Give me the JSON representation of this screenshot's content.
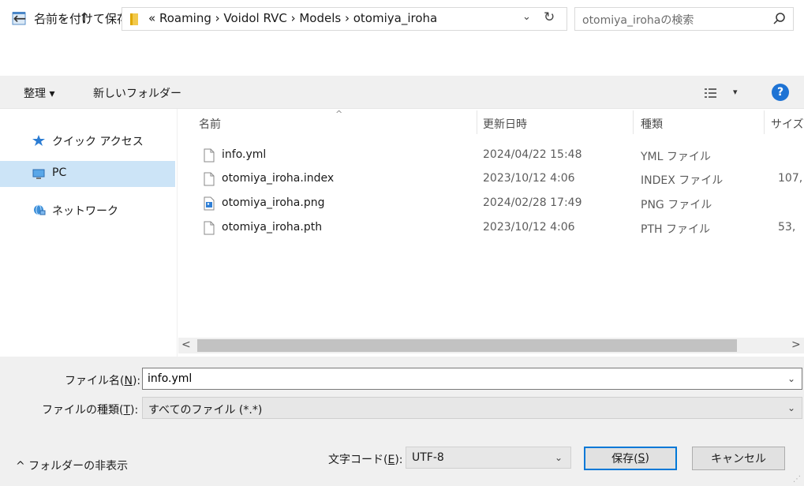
{
  "window": {
    "title": "名前を付けて保存",
    "close_glyph": "✕"
  },
  "address_bar": {
    "back_glyph": "←",
    "forward_glyph": "→",
    "recent_glyph": "⌄",
    "up_glyph": "↑",
    "breadcrumb": "« Roaming › Voidol RVC › Models › otomiya_iroha",
    "dropdown_glyph": "⌄",
    "refresh_glyph": "↻"
  },
  "search": {
    "placeholder": "otomiya_irohaの検索"
  },
  "toolbar": {
    "organize_label": "整理 ▾",
    "new_folder_label": "新しいフォルダー",
    "view_dropdown_glyph": "▾",
    "help_glyph": "?"
  },
  "nav_pane": {
    "items": [
      {
        "label": "クイック アクセス",
        "icon": "star-icon"
      },
      {
        "label": "PC",
        "icon": "computer-icon",
        "selected": true
      },
      {
        "label": "ネットワーク",
        "icon": "network-icon"
      }
    ]
  },
  "file_list": {
    "columns": [
      "名前",
      "更新日時",
      "種類",
      "サイズ"
    ],
    "sort_glyph": "^",
    "rows": [
      {
        "name": "info.yml",
        "date": "2024/04/22 15:48",
        "type": "YML ファイル",
        "size": "",
        "icon": "document-icon"
      },
      {
        "name": "otomiya_iroha.index",
        "date": "2023/10/12 4:06",
        "type": "INDEX ファイル",
        "size": "107,",
        "icon": "document-icon"
      },
      {
        "name": "otomiya_iroha.png",
        "date": "2024/02/28 17:49",
        "type": "PNG ファイル",
        "size": "",
        "icon": "image-file-icon"
      },
      {
        "name": "otomiya_iroha.pth",
        "date": "2023/10/12 4:06",
        "type": "PTH ファイル",
        "size": "53,",
        "icon": "document-icon"
      }
    ]
  },
  "scrollbar": {
    "left_glyph": "<",
    "right_glyph": ">"
  },
  "form": {
    "filename_label": "ファイル名(",
    "filename_key": "N",
    "filename_label_end": "):",
    "filename_value": "info.yml",
    "filetype_label": "ファイルの種類(",
    "filetype_key": "T",
    "filetype_label_end": "):",
    "filetype_value": "すべてのファイル (*.*)",
    "dropdown_glyph": "⌄"
  },
  "footer": {
    "hide_folders_label": "^ フォルダーの非表示",
    "encoding_label": "文字コード(",
    "encoding_key": "E",
    "encoding_label_end": "):",
    "encoding_value": "UTF-8",
    "save_label": "保存(",
    "save_key": "S",
    "save_label_end": ")",
    "cancel_label": "キャンセル",
    "grip_glyph": "⋰"
  },
  "colors": {
    "accent": "#0078d7",
    "selection": "#cce4f7",
    "panel": "#f0f0f0",
    "help": "#1e73d4"
  }
}
